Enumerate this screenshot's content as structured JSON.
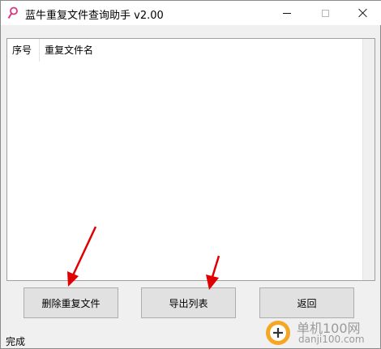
{
  "window": {
    "title": "蓝牛重复文件查询助手 v2.00",
    "icon": "magnifier-icon"
  },
  "list": {
    "columns": [
      "序号",
      "重复文件名"
    ],
    "rows": []
  },
  "buttons": {
    "delete_label": "删除重复文件",
    "export_label": "导出列表",
    "back_label": "返回"
  },
  "status_text": "完成",
  "watermark": {
    "text_top": "单机100网",
    "text_bottom": "danji100.com"
  },
  "colors": {
    "arrow": "#e00000",
    "icon_accent": "#d9367f"
  }
}
